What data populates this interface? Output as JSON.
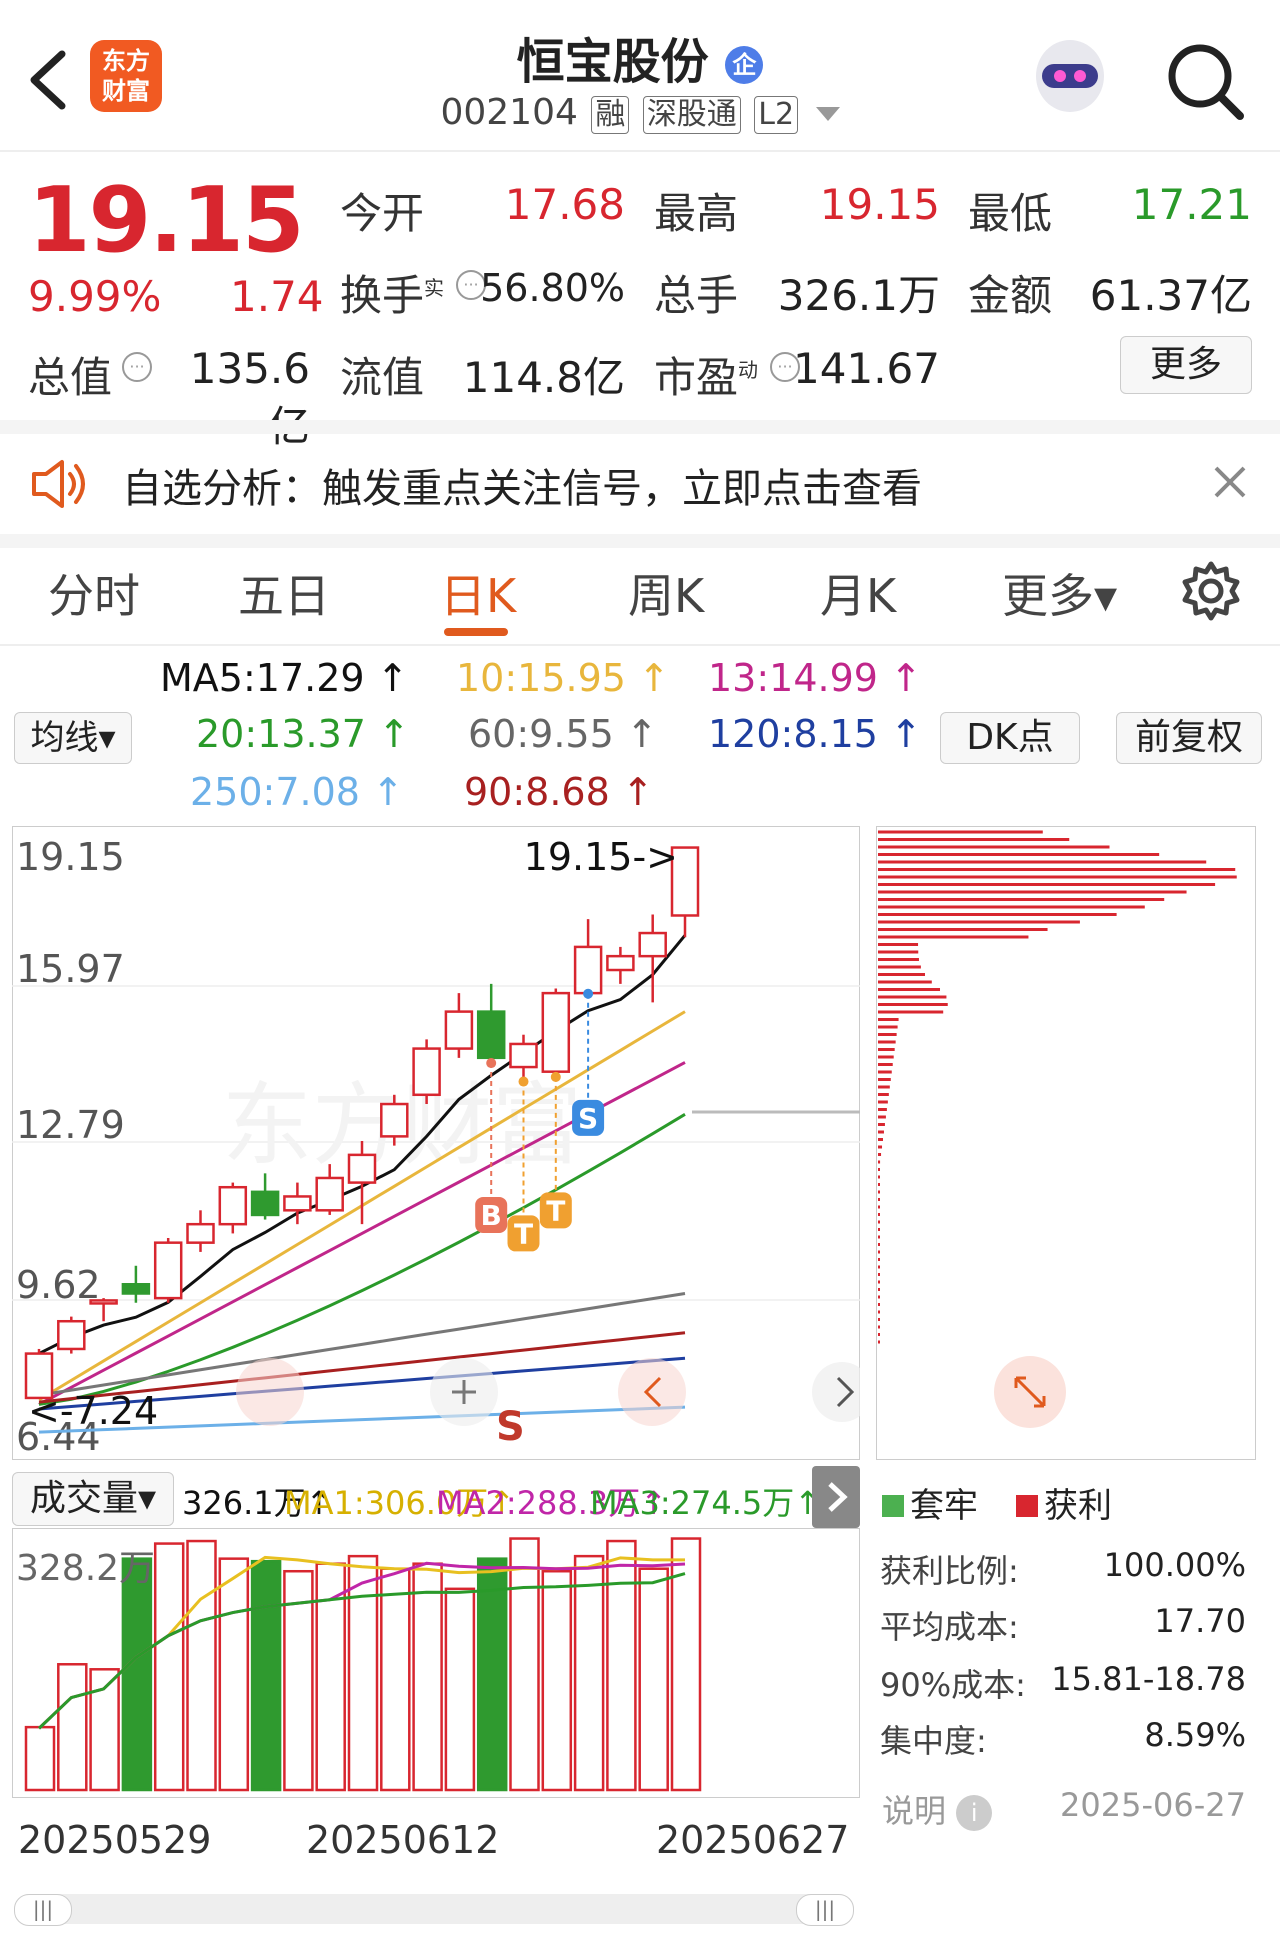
{
  "header": {
    "back_icon": "chevron-left-icon",
    "logo_line1": "东方",
    "logo_line2": "财富",
    "stock_name": "恒宝股份",
    "enterprise_badge": "企",
    "stock_code": "002104",
    "tags": [
      "融",
      "深股通",
      "L2"
    ],
    "search_icon": "search-icon",
    "assistant_icon": "robot-assistant-icon"
  },
  "quote": {
    "price": "19.15",
    "change_pct": "9.99%",
    "change_amt": "1.74",
    "rows": [
      [
        {
          "label": "今开",
          "value": "17.68",
          "color": "red"
        },
        {
          "label": "最高",
          "value": "19.15",
          "color": "red"
        },
        {
          "label": "最低",
          "value": "17.21",
          "color": "green"
        }
      ],
      [
        {
          "label": "换手",
          "sup": "实",
          "value": "56.80%",
          "color": "dark"
        },
        {
          "label": "总手",
          "value": "326.1万",
          "color": "dark"
        },
        {
          "label": "金额",
          "value": "61.37亿",
          "color": "dark"
        }
      ],
      [
        {
          "label": "总值",
          "value": "135.6亿",
          "color": "dark"
        },
        {
          "label": "流值",
          "value": "114.8亿",
          "color": "dark"
        },
        {
          "label": "市盈",
          "sup": "动",
          "value": "141.67",
          "color": "dark"
        }
      ]
    ],
    "more_button": "更多"
  },
  "notice": {
    "speaker_icon": "speaker-icon",
    "text": "自选分析：触发重点关注信号，立即点击查看",
    "close_icon": "close-icon"
  },
  "tabs": {
    "items": [
      "分时",
      "五日",
      "日K",
      "周K",
      "月K",
      "更多▾"
    ],
    "active": "日K",
    "settings_icon": "gear-icon"
  },
  "ma_bar": {
    "dropdown": "均线▾",
    "ma5": "MA5:17.29 ↑",
    "ma10": "10:15.95 ↑",
    "ma13": "13:14.99 ↑",
    "ma20": "20:13.37 ↑",
    "ma60": "60:9.55 ↑",
    "ma120": "120:8.15 ↑",
    "ma250": "250:7.08 ↑",
    "ma90": "90:8.68 ↑",
    "dk_button": "DK点",
    "fq_button": "前复权"
  },
  "kline": {
    "y_labels": [
      "19.15",
      "15.97",
      "12.79",
      "9.62",
      "6.44"
    ],
    "high_marker": "19.15->",
    "low_marker": "<-7.24",
    "watermark": "东方财富",
    "signals": [
      "B",
      "T",
      "T",
      "S"
    ],
    "s_bottom": "S",
    "candles": [
      {
        "o": 7.24,
        "c": 8.2,
        "h": 8.3,
        "l": 7.24
      },
      {
        "o": 8.3,
        "c": 8.9,
        "h": 9.0,
        "l": 8.2
      },
      {
        "o": 9.3,
        "c": 9.35,
        "h": 9.4,
        "l": 8.9
      },
      {
        "o": 9.7,
        "c": 9.5,
        "h": 10.1,
        "l": 9.3
      },
      {
        "o": 9.4,
        "c": 10.6,
        "h": 10.7,
        "l": 9.3
      },
      {
        "o": 10.6,
        "c": 11.0,
        "h": 11.3,
        "l": 10.4
      },
      {
        "o": 11.0,
        "c": 11.8,
        "h": 11.9,
        "l": 10.8
      },
      {
        "o": 11.7,
        "c": 11.2,
        "h": 12.1,
        "l": 11.1
      },
      {
        "o": 11.3,
        "c": 11.6,
        "h": 11.9,
        "l": 11.0
      },
      {
        "o": 11.3,
        "c": 12.0,
        "h": 12.3,
        "l": 11.2
      },
      {
        "o": 11.9,
        "c": 12.5,
        "h": 12.8,
        "l": 11.0
      },
      {
        "o": 12.9,
        "c": 13.6,
        "h": 13.8,
        "l": 12.7
      },
      {
        "o": 13.8,
        "c": 14.8,
        "h": 15.0,
        "l": 13.6
      },
      {
        "o": 14.8,
        "c": 15.6,
        "h": 16.0,
        "l": 14.6
      },
      {
        "o": 15.6,
        "c": 14.6,
        "h": 16.2,
        "l": 14.4
      },
      {
        "o": 14.4,
        "c": 14.9,
        "h": 15.1,
        "l": 14.0
      },
      {
        "o": 14.3,
        "c": 16.0,
        "h": 16.1,
        "l": 14.1
      },
      {
        "o": 16.0,
        "c": 17.0,
        "h": 17.6,
        "l": 15.9
      },
      {
        "o": 16.5,
        "c": 16.8,
        "h": 17.0,
        "l": 16.2
      },
      {
        "o": 16.8,
        "c": 17.3,
        "h": 17.7,
        "l": 15.8
      },
      {
        "o": 17.68,
        "c": 19.15,
        "h": 19.15,
        "l": 17.21
      }
    ]
  },
  "volume": {
    "dropdown": "成交量▾",
    "vol": "326.1万↑",
    "ma1": "MA1:306.0万↑",
    "ma2": "MA2:288.3万↑",
    "ma3": "MA3:274.5万↑",
    "max_label": "328.2万",
    "x_labels": [
      "20250529",
      "20250612",
      "20250627"
    ],
    "bars": [
      0.25,
      0.5,
      0.48,
      0.92,
      0.98,
      0.99,
      0.92,
      0.91,
      0.87,
      0.9,
      0.93,
      0.88,
      0.9,
      0.8,
      0.92,
      1.0,
      0.87,
      0.93,
      0.99,
      0.88,
      1.0
    ]
  },
  "chip": {
    "legend_trapped": "套牢",
    "legend_profit": "获利",
    "rows": [
      {
        "label": "获利比例:",
        "value": "100.00%"
      },
      {
        "label": "平均成本:",
        "value": "17.70"
      },
      {
        "label": "90%成本:",
        "value": "15.81-18.78"
      },
      {
        "label": "集中度:",
        "value": "8.59%"
      }
    ],
    "note_label": "说明",
    "date": "2025-06-27"
  },
  "colors": {
    "up": "#d8262f",
    "down": "#2f9a2f",
    "accent": "#e05a1e"
  }
}
